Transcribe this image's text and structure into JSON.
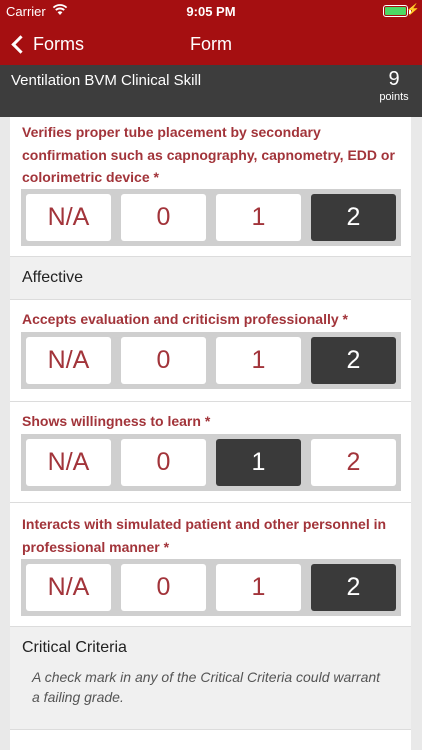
{
  "status_bar": {
    "carrier": "Carrier",
    "time": "9:05 PM"
  },
  "nav": {
    "back_label": "Forms",
    "title": "Form"
  },
  "header": {
    "skill_name": "Ventilation BVM Clinical Skill",
    "points_value": "9",
    "points_label": "points"
  },
  "options": [
    "N/A",
    "0",
    "1",
    "2"
  ],
  "questions": [
    {
      "text": "Verifies proper tube placement by secondary confirmation such as capnography, capnometry, EDD or colorimetric device *",
      "selected": "2"
    },
    {
      "text": "Accepts evaluation and criticism professionally *",
      "selected": "2"
    },
    {
      "text": "Shows willingness to learn *",
      "selected": "1"
    },
    {
      "text": "Interacts with simulated patient and other personnel in professional manner *",
      "selected": "2"
    }
  ],
  "sections": {
    "affective": {
      "title": "Affective"
    },
    "critical": {
      "title": "Critical Criteria",
      "note": "A check mark in any of the Critical Criteria could warrant a failing grade."
    }
  },
  "colors": {
    "nav_bar": "#a50f11",
    "header": "#3d3d3d",
    "question_text": "#a2343a",
    "selected": "#3a3a3a",
    "battery": "#4cd964"
  }
}
